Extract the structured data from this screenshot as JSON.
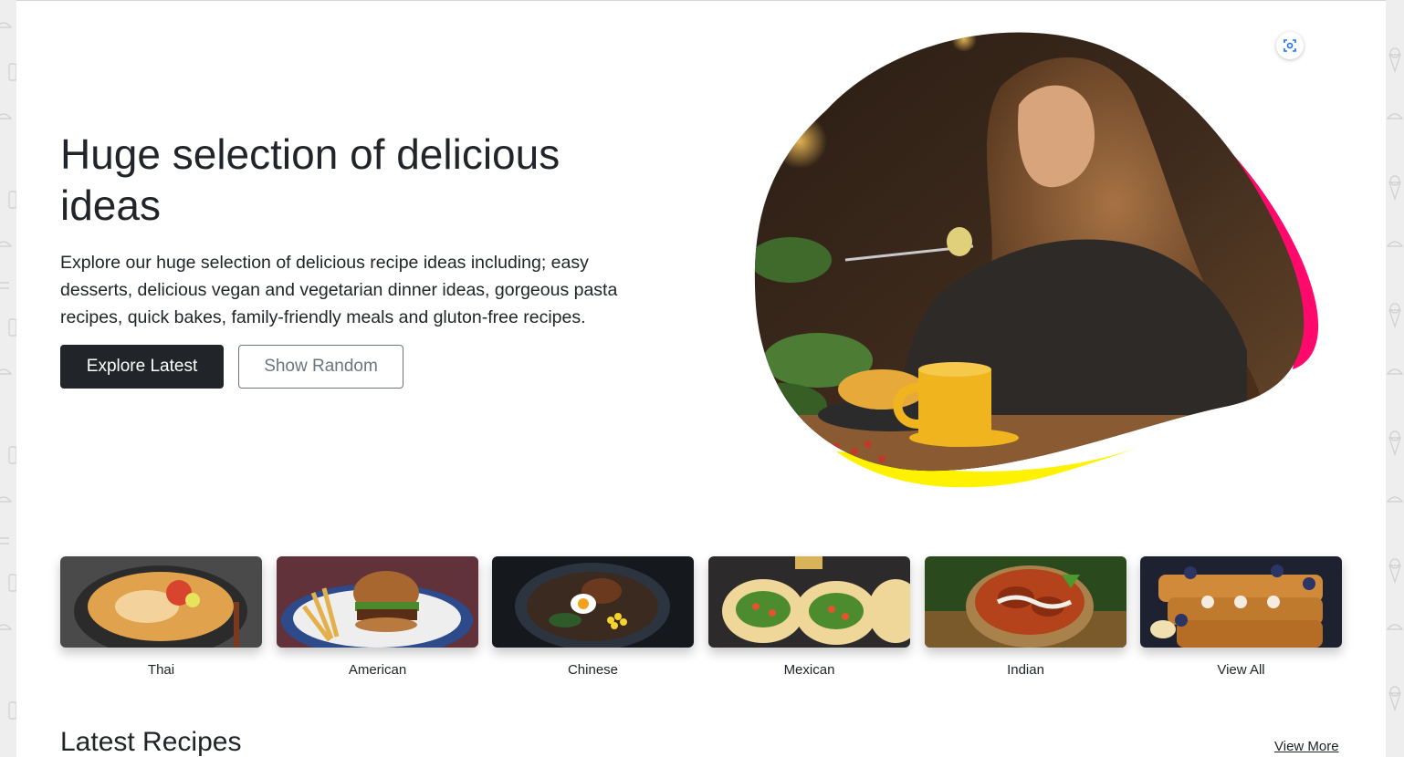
{
  "hero": {
    "title": "Huge selection of delicious ideas",
    "description": "Explore our huge selection of delicious recipe ideas including; easy desserts, delicious vegan and vegetarian dinner ideas, gorgeous pasta recipes, quick bakes, family-friendly meals and gluton-free recipes.",
    "primary_button": "Explore Latest",
    "secondary_button": "Show Random",
    "image_alt": "woman eating food",
    "accent_colors": {
      "pink": "#ff0a6c",
      "yellow": "#fff200"
    },
    "scan_icon": "visual-search-icon"
  },
  "categories": [
    {
      "label": "Thai"
    },
    {
      "label": "American"
    },
    {
      "label": "Chinese"
    },
    {
      "label": "Mexican"
    },
    {
      "label": "Indian"
    },
    {
      "label": "View All"
    }
  ],
  "latest": {
    "title": "Latest Recipes",
    "view_more": "View More"
  }
}
